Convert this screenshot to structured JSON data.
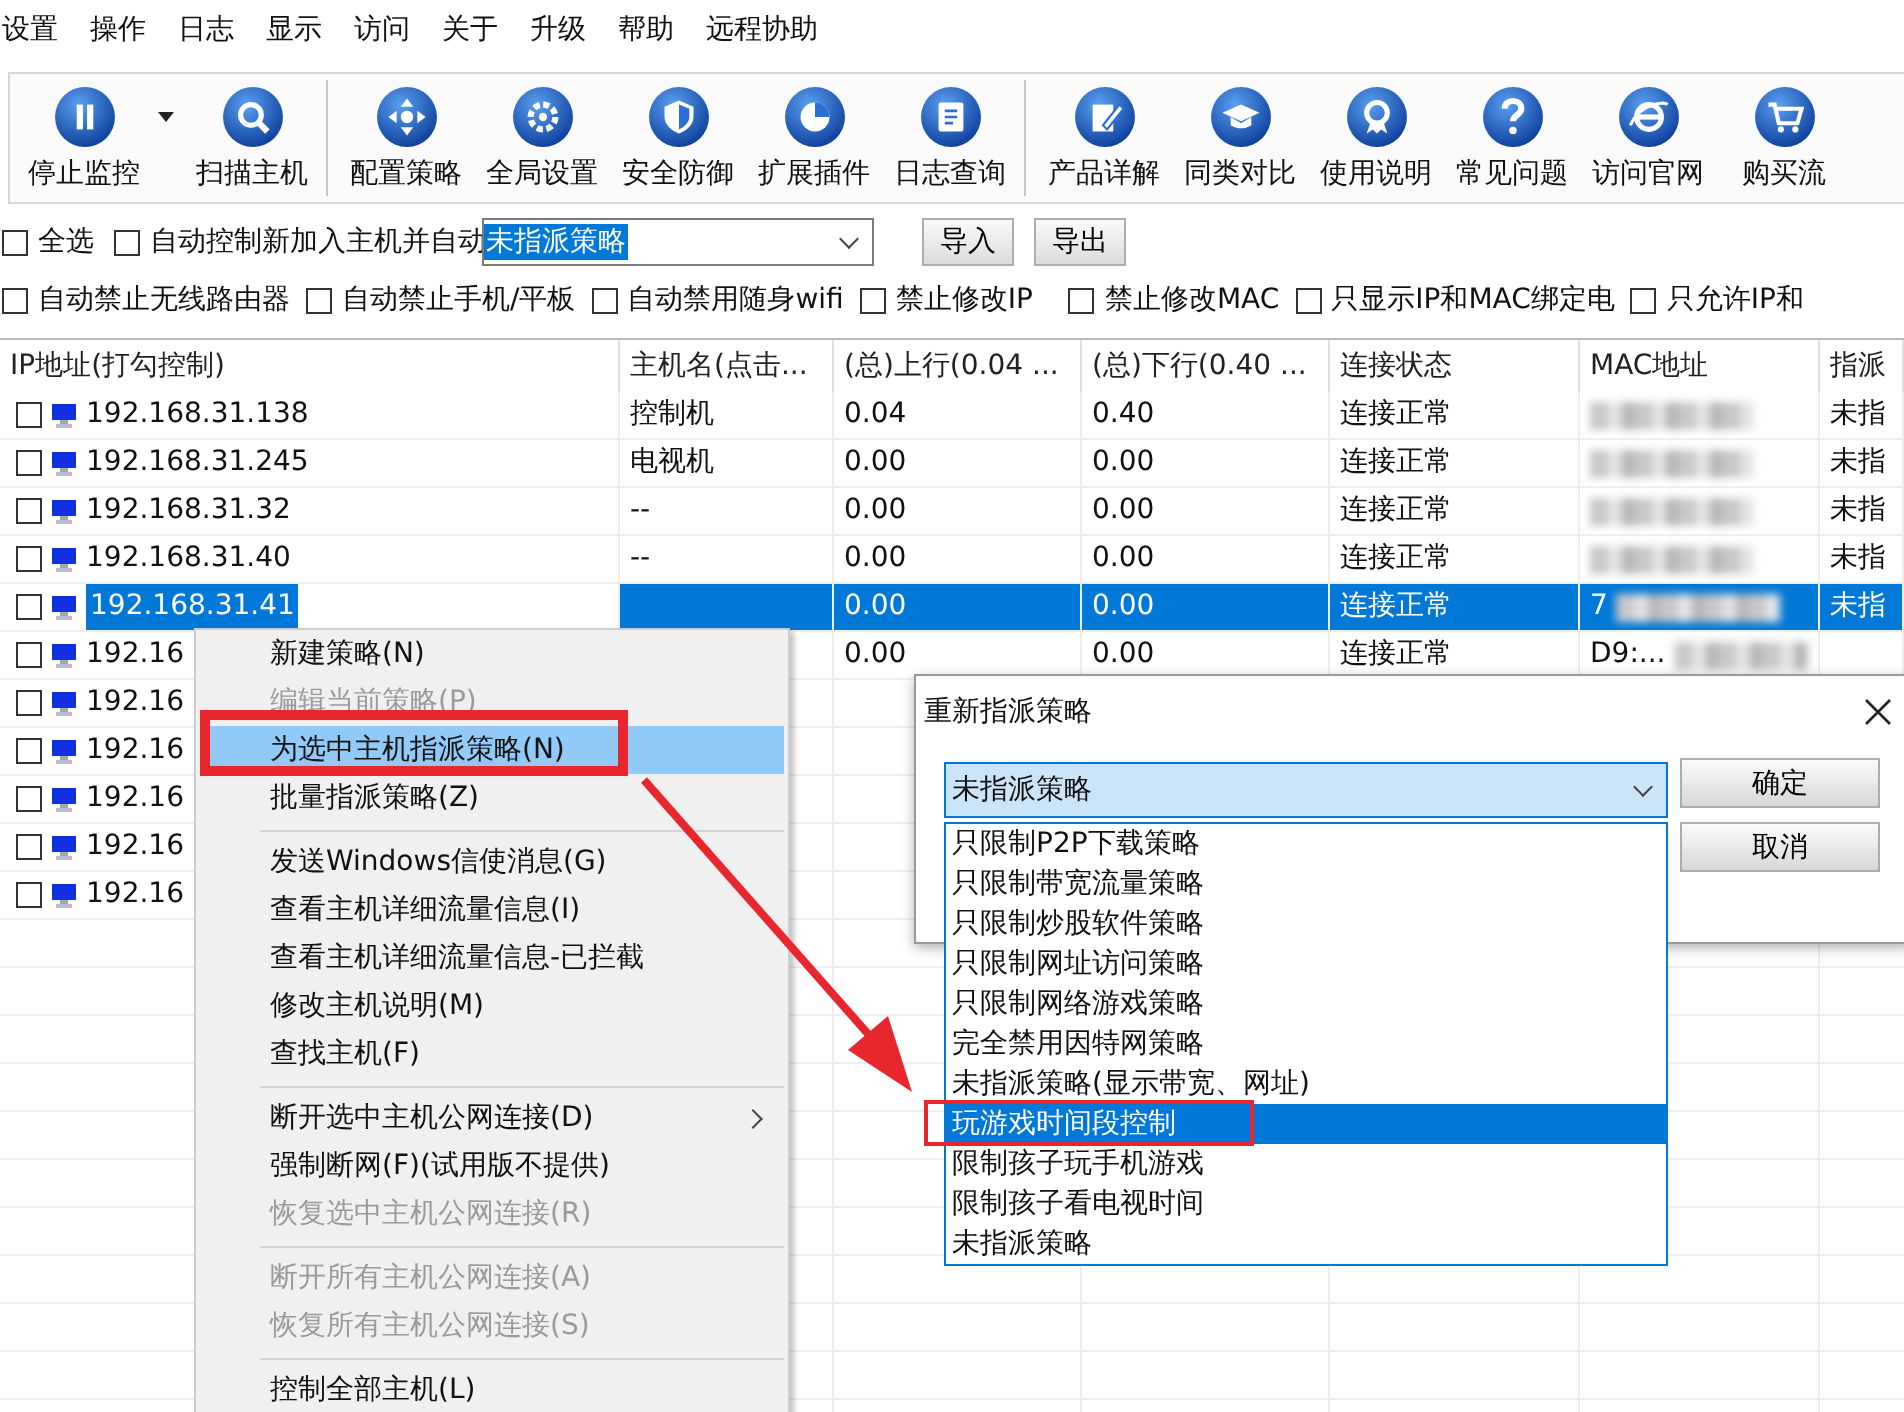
{
  "menu_bar": [
    "设置",
    "操作",
    "日志",
    "显示",
    "访问",
    "关于",
    "升级",
    "帮助",
    "远程协助"
  ],
  "toolbar": {
    "groups": [
      [
        {
          "label": "停止监控",
          "kind": "pause",
          "dropdown": true
        },
        {
          "label": "扫描主机",
          "kind": "search"
        }
      ],
      [
        {
          "label": "配置策略",
          "kind": "move"
        },
        {
          "label": "全局设置",
          "kind": "gear"
        },
        {
          "label": "安全防御",
          "kind": "shield"
        },
        {
          "label": "扩展插件",
          "kind": "pie"
        },
        {
          "label": "日志查询",
          "kind": "book"
        }
      ],
      [
        {
          "label": "产品详解",
          "kind": "edit"
        },
        {
          "label": "同类对比",
          "kind": "cap"
        },
        {
          "label": "使用说明",
          "kind": "award"
        },
        {
          "label": "常见问题",
          "kind": "question"
        },
        {
          "label": "访问官网",
          "kind": "globe"
        },
        {
          "label": "购买流",
          "kind": "cart"
        }
      ]
    ]
  },
  "options_row": {
    "select_all": {
      "label": "全选",
      "checked": false
    },
    "auto_control": {
      "label": "自动控制新加入主机并自动",
      "checked": false
    },
    "policy_select": {
      "value": "未指派策略"
    },
    "buttons": [
      "导入",
      "导出"
    ]
  },
  "restrictions": [
    {
      "label": "自动禁止无线路由器",
      "checked": false
    },
    {
      "label": "自动禁止手机/平板",
      "checked": false
    },
    {
      "label": "自动禁用随身wifi",
      "checked": false
    },
    {
      "label": "禁止修改IP",
      "checked": false
    },
    {
      "label": "禁止修改MAC",
      "checked": false
    },
    {
      "label": "只显示IP和MAC绑定电",
      "checked": false
    },
    {
      "label": "只允许IP和",
      "checked": false
    }
  ],
  "table": {
    "columns": [
      "IP地址(打勾控制)",
      "主机名(点击...",
      "(总)上行(0.04 ...",
      "(总)下行(0.40 ...",
      "连接状态",
      "MAC地址",
      "指派"
    ],
    "rows": [
      {
        "ip": "192.168.31.138",
        "checked": false,
        "selected": false,
        "hostname": "控制机",
        "up": "0.04",
        "down": "0.40",
        "status": "连接正常",
        "mac_blurred": true,
        "policy": "未指"
      },
      {
        "ip": "192.168.31.245",
        "checked": false,
        "selected": false,
        "hostname": "电视机",
        "up": "0.00",
        "down": "0.00",
        "status": "连接正常",
        "mac_blurred": true,
        "policy": "未指"
      },
      {
        "ip": "192.168.31.32",
        "checked": false,
        "selected": false,
        "hostname": "--",
        "up": "0.00",
        "down": "0.00",
        "status": "连接正常",
        "mac_blurred": true,
        "policy": "未指"
      },
      {
        "ip": "192.168.31.40",
        "checked": false,
        "selected": false,
        "hostname": "--",
        "up": "0.00",
        "down": "0.00",
        "status": "连接正常",
        "mac_blurred": true,
        "policy": "未指"
      },
      {
        "ip": "192.168.31.41",
        "checked": false,
        "selected": true,
        "up": "0.00",
        "down": "0.00",
        "status": "连接正常",
        "mac": "7",
        "mac_blurred": true,
        "policy": "未指"
      },
      {
        "ip": "192.16",
        "checked": false,
        "selected": false,
        "up": "0.00",
        "down": "0.00",
        "status": "连接正常",
        "mac": "D9:...",
        "mac_blurred": true
      },
      {
        "ip": "192.16",
        "checked": false,
        "selected": false
      },
      {
        "ip": "192.16",
        "checked": false,
        "selected": false
      },
      {
        "ip": "192.16",
        "checked": false,
        "selected": false
      },
      {
        "ip": "192.16",
        "checked": false,
        "selected": false
      },
      {
        "ip": "192.16",
        "checked": false,
        "selected": false
      }
    ]
  },
  "context_menu": {
    "items": [
      {
        "kind": "item",
        "label": "新建策略(N)",
        "disabled": false,
        "highlighted": false
      },
      {
        "kind": "item",
        "label": "编辑当前策略(P)",
        "disabled": true,
        "highlighted": false
      },
      {
        "kind": "item",
        "label": "为选中主机指派策略(N)",
        "disabled": false,
        "highlighted": true
      },
      {
        "kind": "item",
        "label": "批量指派策略(Z)",
        "disabled": false,
        "highlighted": false
      },
      {
        "kind": "separator"
      },
      {
        "kind": "item",
        "label": "发送Windows信使消息(G)",
        "disabled": false,
        "highlighted": false
      },
      {
        "kind": "item",
        "label": "查看主机详细流量信息(I)",
        "disabled": false,
        "highlighted": false
      },
      {
        "kind": "item",
        "label": "查看主机详细流量信息-已拦截",
        "disabled": false,
        "highlighted": false
      },
      {
        "kind": "item",
        "label": "修改主机说明(M)",
        "disabled": false,
        "highlighted": false
      },
      {
        "kind": "item",
        "label": "查找主机(F)",
        "disabled": false,
        "highlighted": false
      },
      {
        "kind": "separator"
      },
      {
        "kind": "item",
        "label": "断开选中主机公网连接(D)",
        "disabled": false,
        "highlighted": false,
        "submenu": true
      },
      {
        "kind": "item",
        "label": "强制断网(F)(试用版不提供)",
        "disabled": false,
        "highlighted": false
      },
      {
        "kind": "item",
        "label": "恢复选中主机公网连接(R)",
        "disabled": true,
        "highlighted": false
      },
      {
        "kind": "separator"
      },
      {
        "kind": "item",
        "label": "断开所有主机公网连接(A)",
        "disabled": true,
        "highlighted": false
      },
      {
        "kind": "item",
        "label": "恢复所有主机公网连接(S)",
        "disabled": true,
        "highlighted": false
      },
      {
        "kind": "separator"
      },
      {
        "kind": "item",
        "label": "控制全部主机(L)",
        "disabled": false,
        "highlighted": false
      }
    ]
  },
  "dialog": {
    "title": "重新指派策略",
    "combo": {
      "value": "未指派策略"
    },
    "buttons": [
      "确定",
      "取消"
    ],
    "options": [
      {
        "label": "只限制P2P下载策略",
        "selected": false
      },
      {
        "label": "只限制带宽流量策略",
        "selected": false
      },
      {
        "label": "只限制炒股软件策略",
        "selected": false
      },
      {
        "label": "只限制网址访问策略",
        "selected": false
      },
      {
        "label": "只限制网络游戏策略",
        "selected": false
      },
      {
        "label": "完全禁用因特网策略",
        "selected": false
      },
      {
        "label": "未指派策略(显示带宽、网址)",
        "selected": false
      },
      {
        "label": "玩游戏时间段控制",
        "selected": true
      },
      {
        "label": "限制孩子玩手机游戏",
        "selected": false
      },
      {
        "label": "限制孩子看电视时间",
        "selected": false
      },
      {
        "label": "未指派策略",
        "selected": false
      }
    ]
  }
}
